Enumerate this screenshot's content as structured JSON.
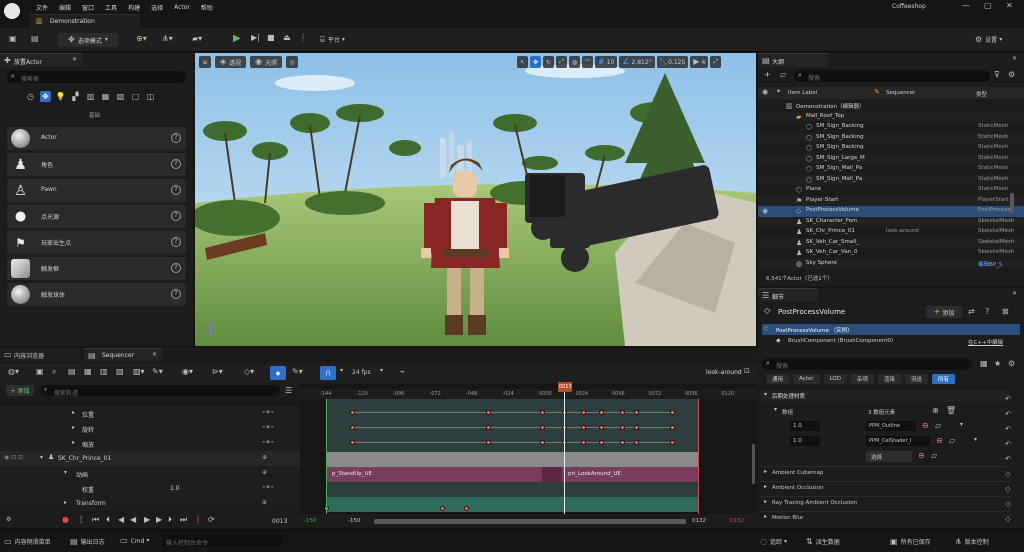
{
  "menu": {
    "items": [
      "文件",
      "编辑",
      "窗口",
      "工具",
      "构建",
      "选择",
      "Actor",
      "帮助"
    ],
    "project_name": "Coffeeshop",
    "tab_title": "Demonstration"
  },
  "toolbar": {
    "mode_label": "选项模式",
    "platform_label": "平台",
    "settings_label": "设置"
  },
  "place_panel": {
    "tab_label": "放置Actor",
    "search_placeholder": "搜索类",
    "category_label": "基础",
    "items": [
      "Actor",
      "角色",
      "Pawn",
      "点光源",
      "玩家出生点",
      "触发框",
      "触发球体"
    ]
  },
  "viewport": {
    "perspective_label": "透视",
    "lit_label": "光照",
    "grid_snap": "10",
    "rotation_snap": "2.812°",
    "scale_snap": "0.125",
    "camera_speed": "4"
  },
  "outliner": {
    "tab_label": "大纲",
    "search_placeholder": "搜索",
    "col_label": "Item Label",
    "col_sequencer": "Sequencer",
    "col_type": "类型",
    "rows": [
      {
        "name": "Demonstration（编辑器）",
        "type": "",
        "extra": "",
        "indent": 38,
        "icon": "level-icon"
      },
      {
        "name": "Mall_Roof_Top",
        "type": "",
        "extra": "",
        "indent": 48,
        "icon": "folder-icon"
      },
      {
        "name": "SM_Sign_Backing",
        "type": "StaticMesh",
        "extra": "",
        "indent": 58,
        "icon": "mesh-icon"
      },
      {
        "name": "SM_Sign_Backing",
        "type": "StaticMesh",
        "extra": "",
        "indent": 58,
        "icon": "mesh-icon"
      },
      {
        "name": "SM_Sign_Backing",
        "type": "StaticMesh",
        "extra": "",
        "indent": 58,
        "icon": "mesh-icon"
      },
      {
        "name": "SM_Sign_Large_M",
        "type": "StaticMesh",
        "extra": "",
        "indent": 58,
        "icon": "mesh-icon"
      },
      {
        "name": "SM_Sign_Mall_Pa",
        "type": "StaticMesh",
        "extra": "",
        "indent": 58,
        "icon": "mesh-icon"
      },
      {
        "name": "SM_Sign_Mall_Pa",
        "type": "StaticMesh",
        "extra": "",
        "indent": 58,
        "icon": "mesh-icon"
      },
      {
        "name": "Plane",
        "type": "StaticMesh",
        "extra": "",
        "indent": 48,
        "icon": "mesh-icon"
      },
      {
        "name": "Player Start",
        "type": "PlayerStart",
        "extra": "",
        "indent": 48,
        "icon": "player-start-icon"
      },
      {
        "name": "PostProcessVolume",
        "type": "PostProcess",
        "extra": "",
        "indent": 48,
        "icon": "volume-icon",
        "selected": true
      },
      {
        "name": "SK_Character_Fem",
        "type": "SkeletalMesh",
        "extra": "",
        "indent": 48,
        "icon": "skeleton-icon"
      },
      {
        "name": "SK_Chr_Prince_01",
        "type": "SkeletalMesh",
        "extra": "look-around",
        "indent": 48,
        "icon": "skeleton-icon"
      },
      {
        "name": "SK_Veh_Car_Small_",
        "type": "SkeletalMesh",
        "extra": "",
        "indent": 48,
        "icon": "skeleton-icon"
      },
      {
        "name": "SK_Veh_Car_Van_0",
        "type": "SkeletalMesh",
        "extra": "",
        "indent": 48,
        "icon": "skeleton-icon"
      },
      {
        "name": "Sky Sphere",
        "type": "编辑BP_S",
        "extra": "",
        "indent": 48,
        "icon": "sky-icon",
        "link": true
      }
    ],
    "count_text": "6,541个Actor（已选1个）"
  },
  "details": {
    "tab_label": "细节",
    "object_name": "PostProcessVolume",
    "add_label": "添加",
    "instance_label": "PostProcessVolume （实例）",
    "component_label": "BrushComponent (BrushComponent0)",
    "edit_cpp_label": "在C++中编辑",
    "search_placeholder": "搜索",
    "filter_tabs": [
      "通用",
      "Actor",
      "LOD",
      "杂项",
      "渲染",
      "流送",
      "所有"
    ],
    "section_label": "后期处理材质",
    "array_label": "数组",
    "array_count": "3 数组元素",
    "elements": [
      {
        "weight": "1.0",
        "material": "PPM_Outline"
      },
      {
        "weight": "1.0",
        "material": "PPM_CelShader_I"
      },
      {
        "weight": "",
        "material": "选择"
      }
    ],
    "sections": [
      "Ambient Cubemap",
      "Ambient Occlusion",
      "Ray Tracing Ambient Occlusion",
      "Motion Blur"
    ]
  },
  "sequencer": {
    "tab_content_browser": "内容浏览器",
    "tab_sequencer": "Sequencer",
    "fps_label": "24 fps",
    "sequence_name": "look-around",
    "add_label": "+ 添加",
    "search_placeholder": "搜索轨道",
    "current_frame": "0013",
    "playhead_frame": "0013",
    "tracks": [
      {
        "name": "位置",
        "indent": 82,
        "value": ""
      },
      {
        "name": "旋转",
        "indent": 82,
        "value": ""
      },
      {
        "name": "缩放",
        "indent": 82,
        "value": ""
      },
      {
        "name": "SK_Chr_Prince_01",
        "indent": 56,
        "value": ""
      },
      {
        "name": "动画",
        "indent": 74,
        "value": ""
      },
      {
        "name": "权重",
        "indent": 82,
        "value": "1.0"
      },
      {
        "name": "Transform",
        "indent": 74,
        "value": ""
      }
    ],
    "ruler_labels": [
      "-144",
      "-120",
      "-096",
      "-072",
      "-048",
      "-024",
      "0000",
      "0024",
      "0048",
      "0072",
      "0096",
      "0120"
    ],
    "section_labels": [
      "p_StandUp_UE",
      "pri_LookAround_UE"
    ],
    "range_start": "-150",
    "range_start_2": "-150",
    "range_end": "0132",
    "range_end_2": "0132"
  },
  "statusbar": {
    "content_drawer": "内容侧滑菜单",
    "output_log": "输出日志",
    "cmd_label": "Cmd",
    "cmd_placeholder": "输入控制台命令",
    "trace_label": "追踪",
    "derived_data": "派生数据",
    "all_saved": "所有已保存",
    "source_control": "版本控制"
  }
}
